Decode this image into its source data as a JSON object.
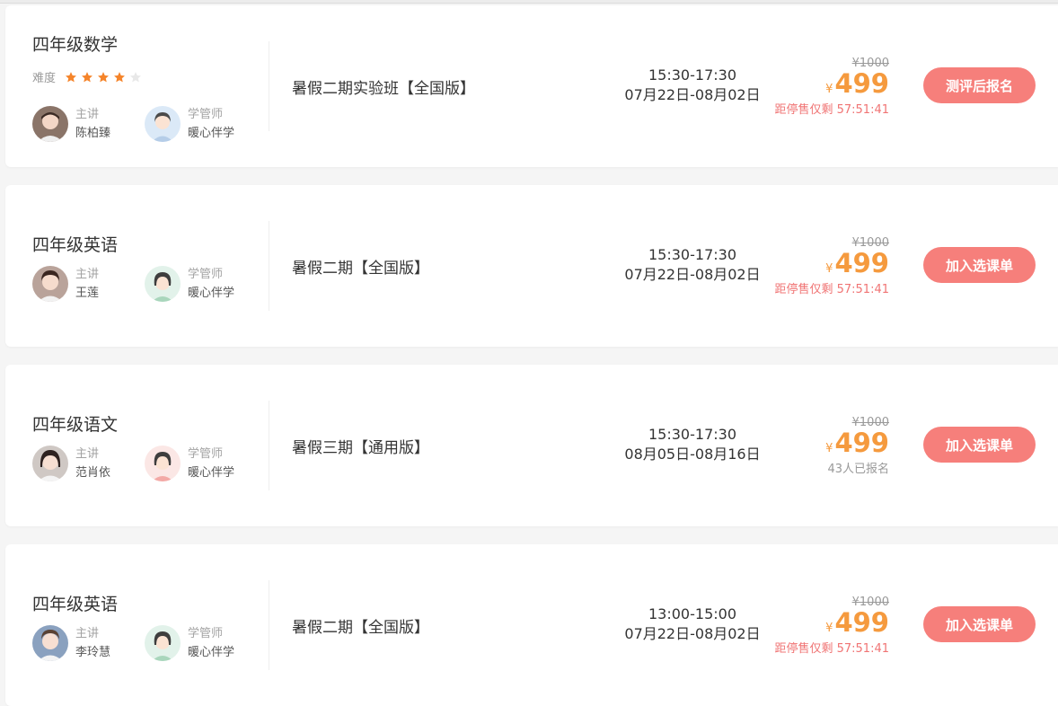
{
  "colors": {
    "accent": "#f67f7b",
    "price": "#f59a3e",
    "warn": "#f07474",
    "star_on": "#f5842a",
    "star_off": "#e8e8e8"
  },
  "courses": [
    {
      "subject": "四年级数学",
      "difficulty_label": "难度",
      "difficulty_stars": 4,
      "difficulty_max": 5,
      "teacher": {
        "role": "主讲",
        "name": "陈柏臻",
        "avatar_icon": "teacher-avatar"
      },
      "tutor": {
        "role": "学管师",
        "name": "暖心伴学",
        "avatar_icon": "tutor-avatar"
      },
      "course_name": "暑假二期实验班【全国版】",
      "time": "15:30-17:30",
      "dates": "07月22日-08月02日",
      "original_price": "¥1000",
      "currency": "¥",
      "price": "499",
      "note": "距停售仅剩 57:51:41",
      "button": "测评后报名"
    },
    {
      "subject": "四年级英语",
      "teacher": {
        "role": "主讲",
        "name": "王莲",
        "avatar_icon": "teacher-avatar"
      },
      "tutor": {
        "role": "学管师",
        "name": "暖心伴学",
        "avatar_icon": "tutor-avatar"
      },
      "course_name": "暑假二期【全国版】",
      "time": "15:30-17:30",
      "dates": "07月22日-08月02日",
      "original_price": "¥1000",
      "currency": "¥",
      "price": "499",
      "note": "距停售仅剩 57:51:41",
      "button": "加入选课单"
    },
    {
      "subject": "四年级语文",
      "teacher": {
        "role": "主讲",
        "name": "范肖依",
        "avatar_icon": "teacher-avatar"
      },
      "tutor": {
        "role": "学管师",
        "name": "暖心伴学",
        "avatar_icon": "tutor-avatar"
      },
      "course_name": "暑假三期【通用版】",
      "time": "15:30-17:30",
      "dates": "08月05日-08月16日",
      "original_price": "¥1000",
      "currency": "¥",
      "price": "499",
      "note": "43人已报名",
      "button": "加入选课单"
    },
    {
      "subject": "四年级英语",
      "teacher": {
        "role": "主讲",
        "name": "李玲慧",
        "avatar_icon": "teacher-avatar"
      },
      "tutor": {
        "role": "学管师",
        "name": "暖心伴学",
        "avatar_icon": "tutor-avatar"
      },
      "course_name": "暑假二期【全国版】",
      "time": "13:00-15:00",
      "dates": "07月22日-08月02日",
      "original_price": "¥1000",
      "currency": "¥",
      "price": "499",
      "note": "距停售仅剩 57:51:41",
      "button": "加入选课单"
    }
  ]
}
